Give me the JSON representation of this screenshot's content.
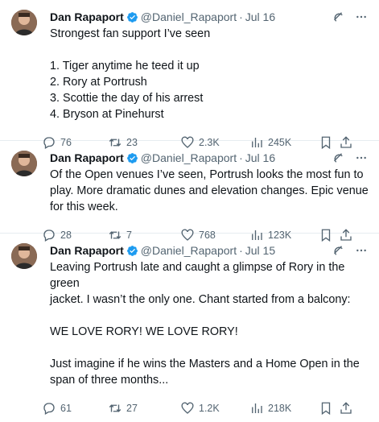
{
  "tweets": [
    {
      "author": "Dan Rapaport",
      "handle": "@Daniel_Rapaport",
      "date": "Jul 16",
      "lines": [
        "Strongest fan support I’ve seen",
        "",
        "1. Tiger anytime he teed it up",
        "2. Rory at Portrush",
        "3. Scottie the day of his arrest",
        "4. Bryson at Pinehurst"
      ],
      "replies": "76",
      "retweets": "23",
      "likes": "2.3K",
      "views": "245K"
    },
    {
      "author": "Dan Rapaport",
      "handle": "@Daniel_Rapaport",
      "date": "Jul 16",
      "lines": [
        "Of the Open venues I’ve seen, Portrush looks the most fun to",
        "play. More dramatic dunes and elevation changes. Epic venue",
        "for this week."
      ],
      "replies": "28",
      "retweets": "7",
      "likes": "768",
      "views": "123K"
    },
    {
      "author": "Dan Rapaport",
      "handle": "@Daniel_Rapaport",
      "date": "Jul 15",
      "lines": [
        "Leaving Portrush late and caught a glimpse of Rory in the green",
        "jacket. I wasn’t the only one. Chant started from a balcony:",
        "",
        "WE LOVE RORY! WE LOVE RORY!",
        "",
        "Just imagine if he wins the Masters and a Home Open in the",
        "span of three months..."
      ],
      "replies": "61",
      "retweets": "27",
      "likes": "1.2K",
      "views": "218K"
    }
  ],
  "separator": "·",
  "colors": {
    "text": "#0f1419",
    "secondary": "#536471",
    "verified": "#1d9bf0",
    "divider": "#e6ecf0"
  },
  "icons": [
    "verified-badge-icon",
    "grok-icon",
    "more-icon",
    "reply-icon",
    "retweet-icon",
    "like-icon",
    "views-icon",
    "bookmark-icon",
    "share-icon"
  ]
}
